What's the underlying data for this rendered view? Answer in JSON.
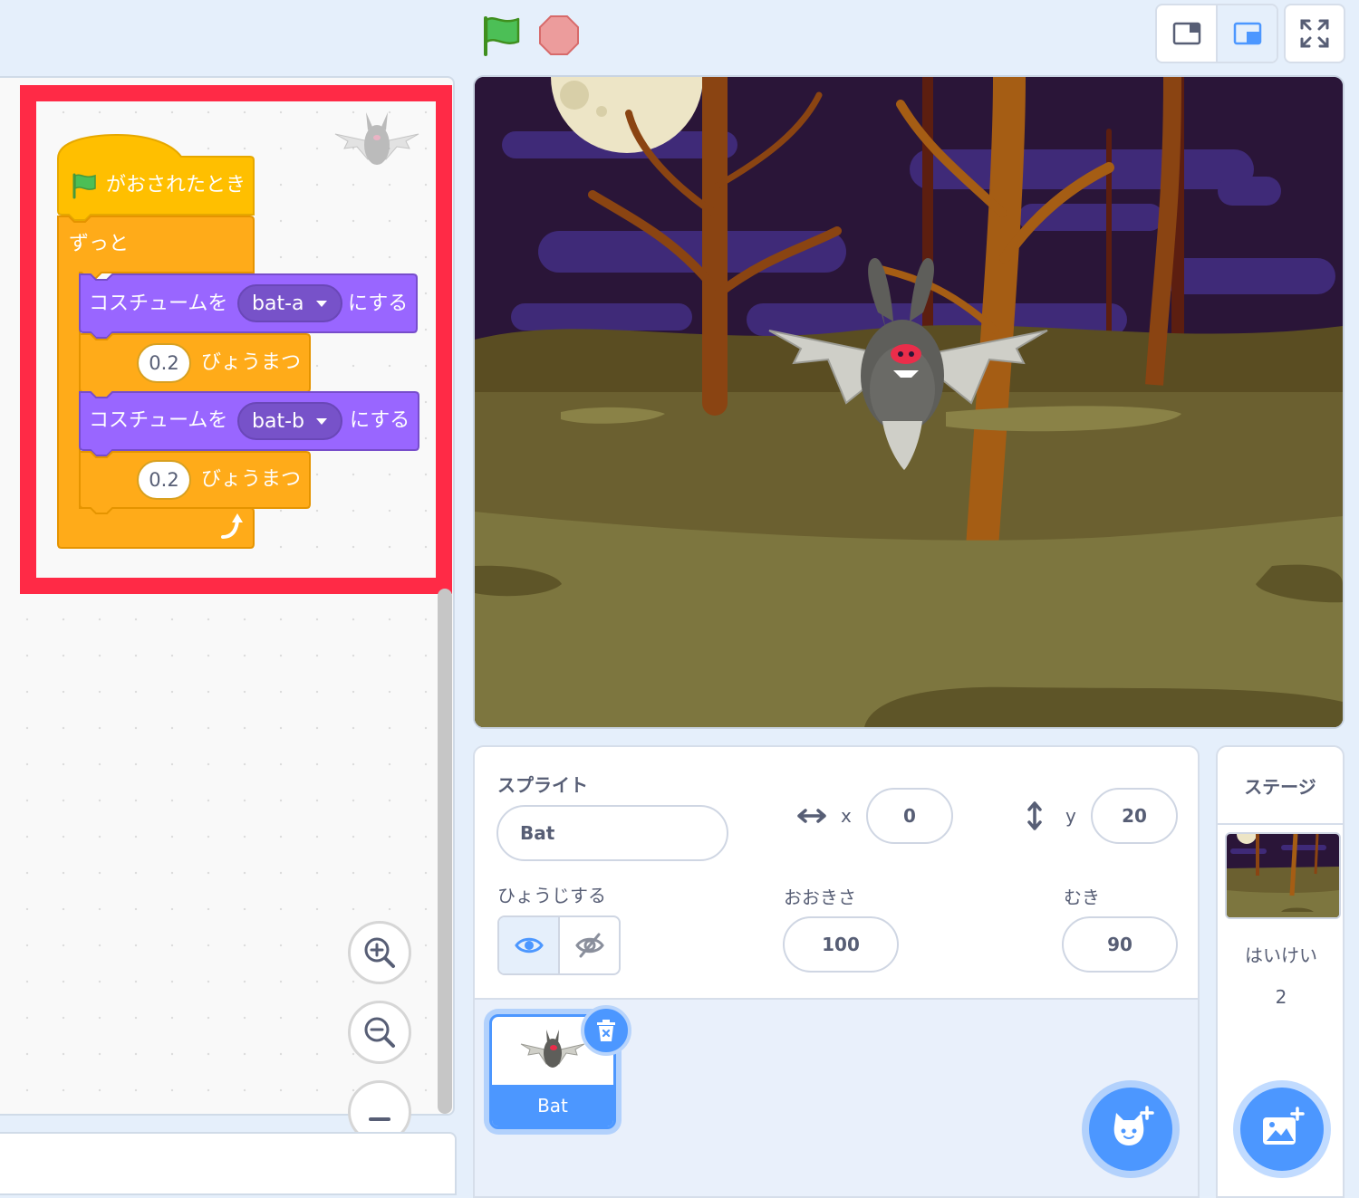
{
  "scripts": {
    "hat_label": "がおされたとき",
    "forever_label": "ずっと",
    "switch_costume_1": {
      "prefix": "コスチュームを",
      "value": "bat-a",
      "suffix": "にする"
    },
    "wait_1": {
      "value": "0.2",
      "suffix": "びょうまつ"
    },
    "switch_costume_2": {
      "prefix": "コスチュームを",
      "value": "bat-b",
      "suffix": "にする"
    },
    "wait_2": {
      "value": "0.2",
      "suffix": "びょうまつ"
    }
  },
  "sprite_info": {
    "title": "スプライト",
    "name_value": "Bat",
    "x_label": "x",
    "x_value": "0",
    "y_label": "y",
    "y_value": "20",
    "show_label": "ひょうじする",
    "size_label": "おおきさ",
    "size_value": "100",
    "direction_label": "むき",
    "direction_value": "90"
  },
  "sprite_list": [
    {
      "name": "Bat"
    }
  ],
  "stage_panel": {
    "title": "ステージ",
    "backdrops_label": "はいけい",
    "backdrops_count": "2"
  },
  "icons": {
    "green_flag": "green-flag-icon",
    "stop": "stop-icon",
    "small_stage": "small-stage-icon",
    "normal_stage": "normal-stage-icon",
    "fullscreen": "fullscreen-icon",
    "zoom_in": "zoom-in-icon",
    "zoom_out": "zoom-out-icon",
    "zoom_reset": "zoom-reset-icon",
    "show": "eye-icon",
    "hide": "eye-slash-icon",
    "delete": "trash-icon",
    "add_sprite": "add-sprite-icon",
    "add_backdrop": "add-backdrop-icon"
  },
  "colors": {
    "events": "#ffbf00",
    "control": "#ffab19",
    "looks": "#9966ff",
    "accent": "#4c97ff",
    "highlight": "#ff2a46"
  }
}
